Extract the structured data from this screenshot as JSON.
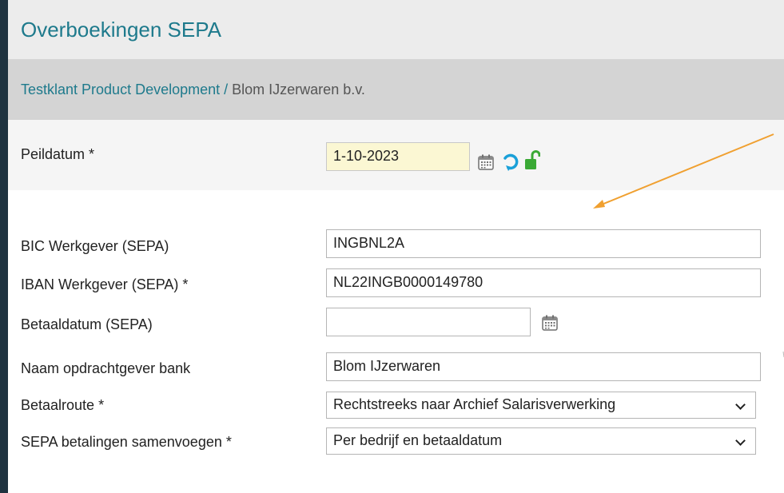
{
  "header": {
    "title": "Overboekingen SEPA"
  },
  "breadcrumb": {
    "link": "Testklant Product Development",
    "separator": " / ",
    "current": "Blom IJzerwaren b.v."
  },
  "peildatum": {
    "label": "Peildatum *",
    "value": "1-10-2023"
  },
  "icons": {
    "calendar": "calendar-icon",
    "refresh": "refresh-icon",
    "lock": "unlocked-padlock-icon"
  },
  "colors": {
    "accent": "#1e7a8c",
    "date_field": "#fbf7d3",
    "lock_green": "#3aa935",
    "refresh_blue": "#1aa0d8",
    "annotation_arrow": "#f0a030"
  },
  "form": {
    "bic": {
      "label": "BIC Werkgever (SEPA)",
      "value": "INGBNL2A"
    },
    "iban": {
      "label": "IBAN Werkgever (SEPA) *",
      "value": "NL22INGB0000149780"
    },
    "betaaldatum": {
      "label": "Betaaldatum (SEPA)",
      "value": ""
    },
    "naam": {
      "label": "Naam opdrachtgever bank",
      "value": "Blom IJzerwaren"
    },
    "betaalroute": {
      "label": "Betaalroute *",
      "value": "Rechtstreeks naar Archief Salarisverwerking"
    },
    "samenvoegen": {
      "label": "SEPA betalingen samenvoegen *",
      "value": "Per bedrijf en betaaldatum"
    }
  }
}
